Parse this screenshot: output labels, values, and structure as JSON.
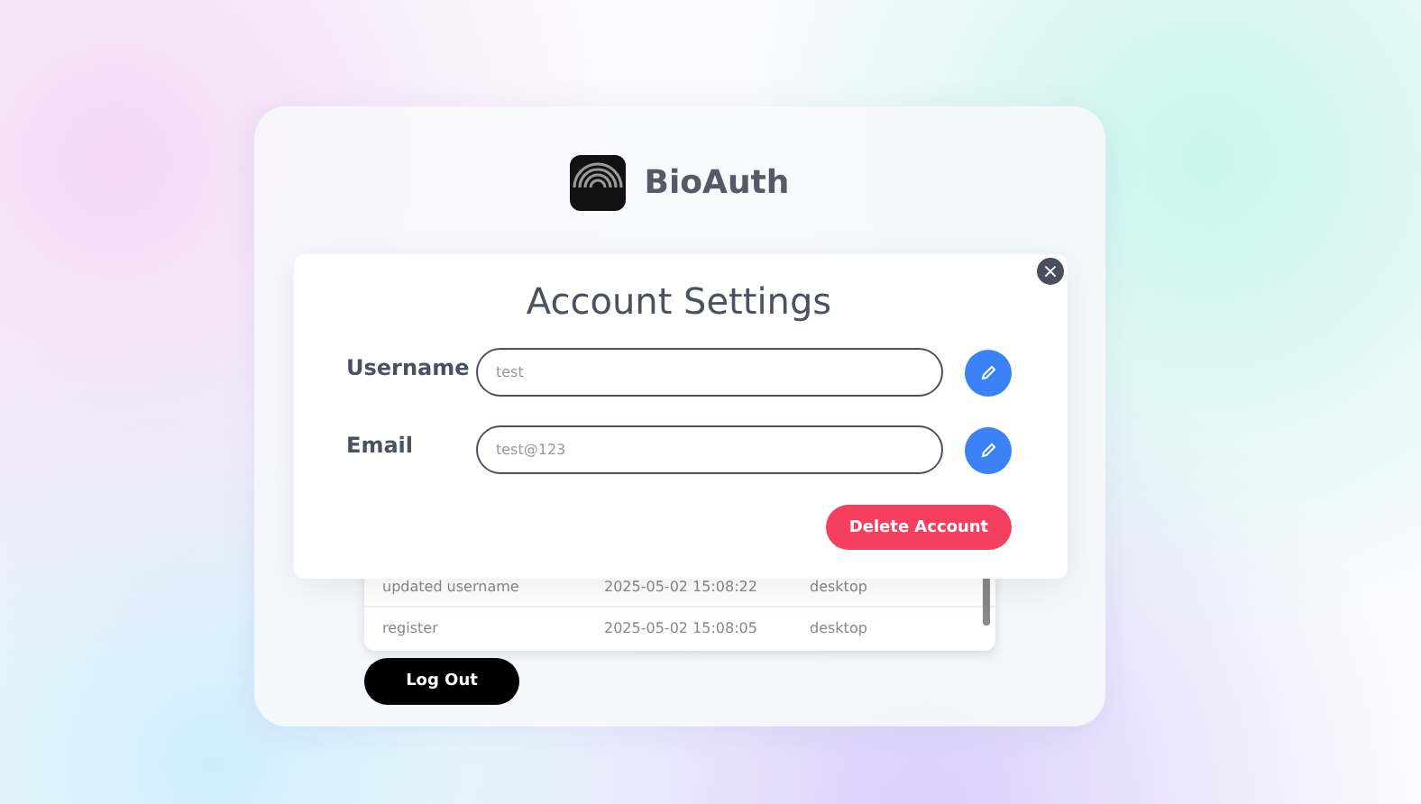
{
  "app": {
    "name": "BioAuth"
  },
  "activity_table": {
    "rows": [
      {
        "action": "updated username",
        "time": "2025-05-02 15:08:22",
        "device": "desktop"
      },
      {
        "action": "register",
        "time": "2025-05-02 15:08:05",
        "device": "desktop"
      }
    ]
  },
  "logout_button": "Log Out",
  "modal": {
    "title": "Account Settings",
    "close": "×",
    "fields": [
      {
        "label": "Username",
        "value": "test"
      },
      {
        "label": "Email",
        "value": "test@123"
      }
    ],
    "delete_button": "Delete Account"
  }
}
